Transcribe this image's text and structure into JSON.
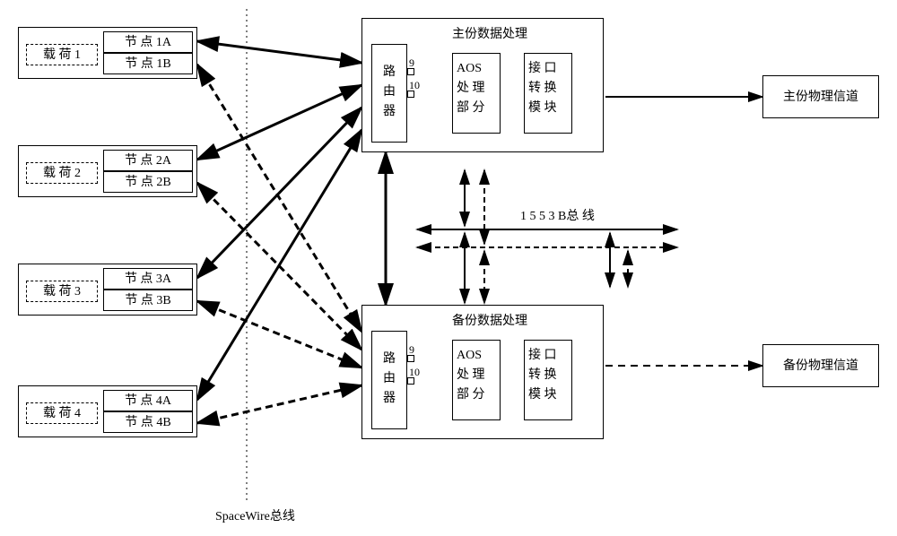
{
  "payloads": [
    {
      "label": "载 荷 1",
      "nodeA": "节 点 1A",
      "nodeB": "节 点 1B"
    },
    {
      "label": "载 荷 2",
      "nodeA": "节 点 2A",
      "nodeB": "节 点 2B"
    },
    {
      "label": "载 荷 3",
      "nodeA": "节 点 3A",
      "nodeB": "节 点 3B"
    },
    {
      "label": "载 荷 4",
      "nodeA": "节 点 4A",
      "nodeB": "节 点 4B"
    }
  ],
  "primaryProcessor": {
    "title": "主份数据处理",
    "router": "路\n由\n器",
    "aos": "AOS\n处 理\n部 分",
    "intf": "接 口\n转 换\n模 块",
    "port9": "9",
    "port10": "10"
  },
  "backupProcessor": {
    "title": "备份数据处理",
    "router": "路\n由\n器",
    "aos": "AOS\n处 理\n部 分",
    "intf": "接 口\n转 换\n模 块",
    "port9": "9",
    "port10": "10"
  },
  "primaryChannel": "主份物理信道",
  "backupChannel": "备份物理信道",
  "bus1553b": "1 5 5 3 B总 线",
  "spacewire": "SpaceWire总线"
}
